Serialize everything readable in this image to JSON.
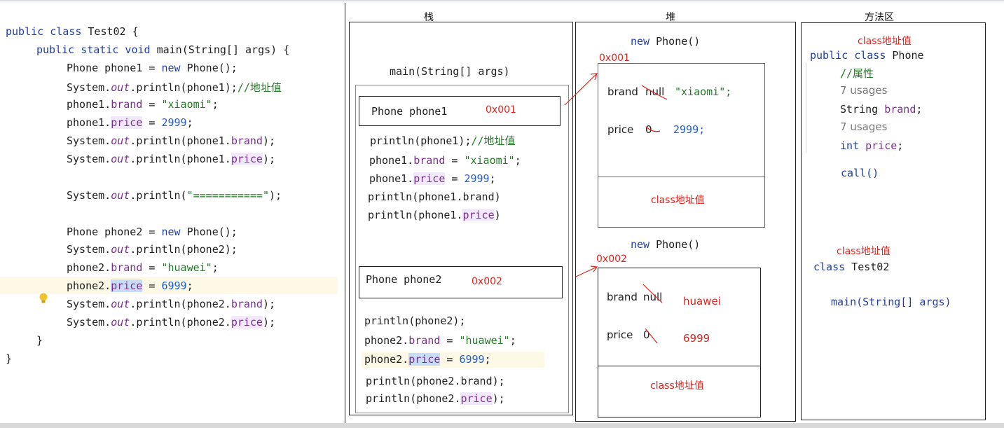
{
  "code": {
    "l1_kw": "public class",
    "l1_rest": " Test02 {",
    "l2_kw": "public static void",
    "l2_rest": " main(String[] args) {",
    "l3_a": "Phone phone1 = ",
    "l3_new": "new",
    "l3_b": " Phone();",
    "l4_a": "System.",
    "l4_out": "out",
    "l4_b": ".println(phone1);",
    "l4_cm": "//地址值",
    "l5_a": "phone1.",
    "l5_f": "brand",
    "l5_b": " = ",
    "l5_s": "\"xiaomi\"",
    "l5_c": ";",
    "l6_a": "phone1.",
    "l6_f": "price",
    "l6_b": " = ",
    "l6_n": "2999",
    "l6_c": ";",
    "l7_a": "System.",
    "l7_out": "out",
    "l7_b": ".println(phone1.",
    "l7_f": "brand",
    "l7_c": ");",
    "l8_a": "System.",
    "l8_out": "out",
    "l8_b": ".println(phone1.",
    "l8_f": "price",
    "l8_c": ");",
    "l9_a": "System.",
    "l9_out": "out",
    "l9_b": ".println(",
    "l9_s": "\"===========\"",
    "l9_c": ");",
    "l10_a": "Phone phone2 = ",
    "l10_new": "new",
    "l10_b": " Phone();",
    "l11_a": "System.",
    "l11_out": "out",
    "l11_b": ".println(phone2);",
    "l12_a": "phone2.",
    "l12_f": "brand",
    "l12_b": " = ",
    "l12_s": "\"huawei\"",
    "l12_c": ";",
    "l13_a": "phone2.",
    "l13_f": "price",
    "l13_b": " = ",
    "l13_n": "6999",
    "l13_c": ";",
    "l14_a": "System.",
    "l14_out": "out",
    "l14_b": ".println(phone2.",
    "l14_f": "brand",
    "l14_c": ");",
    "l15_a": "System.",
    "l15_out": "out",
    "l15_b": ".println(phone2.",
    "l15_f": "price",
    "l15_c": ");",
    "close1": "}",
    "close2": "}"
  },
  "headers": {
    "stack": "栈",
    "heap": "堆",
    "method": "方法区"
  },
  "stack": {
    "main_label": "main(String[] args)",
    "var1": "Phone phone1",
    "addr1": "0x001",
    "s1_a": "println(phone1);",
    "s1_cm": "//地址值",
    "s2_a": "phone1.",
    "s2_f": "brand",
    "s2_b": " = ",
    "s2_s": "\"xiaomi\"",
    "s2_c": ";",
    "s3_a": "phone1.",
    "s3_f": "price",
    "s3_b": " = ",
    "s3_n": "2999",
    "s3_c": ";",
    "s4": "println(phone1.brand)",
    "s5_a": "println(phone1.",
    "s5_f": "price",
    "s5_c": ")",
    "var2": "Phone phone2",
    "addr2": "0x002",
    "t1": "println(phone2);",
    "t2_a": "phone2.",
    "t2_f": "brand",
    "t2_b": " = ",
    "t2_s": "\"huawei\"",
    "t2_c": ";",
    "t3_a": "phone2.",
    "t3_f": "price",
    "t3_b": " = ",
    "t3_n": "6999",
    "t3_c": ";",
    "t4": "println(phone2.brand);",
    "t5_a": "println(phone2.",
    "t5_f": "price",
    "t5_c": ");"
  },
  "heap": {
    "obj1": {
      "new_kw": "new",
      "new_rest": " Phone()",
      "addr": "0x001",
      "brand_label": "brand",
      "brand_default": "null",
      "brand_value": "\"xiaomi\";",
      "price_label": "price",
      "price_default": "0",
      "price_value": "2999;",
      "class_addr": "class地址值"
    },
    "obj2": {
      "new_kw": "new",
      "new_rest": " Phone()",
      "addr": "0x002",
      "brand_label": "brand",
      "brand_default": "null",
      "brand_value": "huawei",
      "price_label": "price",
      "price_default": "0",
      "price_value": "6999",
      "class_addr": "class地址值"
    }
  },
  "method_area": {
    "class1_addr": "class地址值",
    "class1_kw": "public class",
    "class1_name": " Phone",
    "comment": "//属性",
    "usages1": "7 usages",
    "field1_type": "String",
    "field1_name": "brand",
    "field1_end": ";",
    "usages2": "7 usages",
    "field2_type": "int",
    "field2_name": "price",
    "field2_end": ";",
    "method": "call()",
    "class2_addr": "class地址值",
    "class2_kw": "class",
    "class2_name": " Test02",
    "class2_method": "main(String[] args)"
  },
  "colors": {
    "keyword": "#1f3fa8",
    "string": "#237a26",
    "number": "#1c5fd1",
    "field": "#7a2f8f",
    "red_annotation": "#e0241d",
    "current_line": "#fdf9e6"
  },
  "icons": {
    "gutter": "lightbulb-icon"
  }
}
